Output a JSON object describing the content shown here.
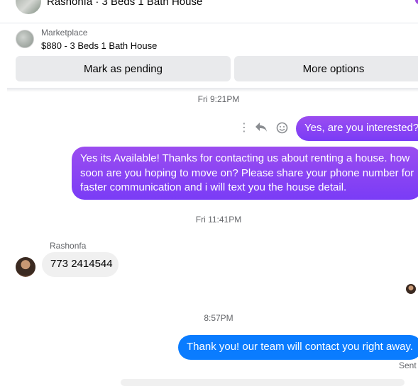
{
  "header": {
    "title": "Rashonfa · 3 Beds 1 Bath House"
  },
  "marketplace": {
    "label": "Marketplace",
    "listing": "$880 - 3 Beds 1 Bath House",
    "mark_pending_label": "Mark as pending",
    "more_options_label": "More options"
  },
  "timestamps": {
    "t1": "Fri 9:21PM",
    "t2": "Fri 11:41PM",
    "t3": "8:57PM"
  },
  "messages": {
    "m1": "Yes, are you interested?",
    "m2": "Yes its Available! Thanks for contacting us about renting a house. how soon are you hoping to move on? Please share your phone number for faster communication and i will text you the house detail.",
    "sender_name": "Rashonfa",
    "m3": "773 2414544",
    "m4": "Thank you! our team will contact you right away.",
    "status": "Sent"
  },
  "colors": {
    "outgoing_purple": "#8a3ffc",
    "outgoing_blue": "#0a7cff",
    "incoming_grey": "#f0f0f0"
  },
  "icons": [
    "more-vertical-icon",
    "reply-icon",
    "emoji-icon"
  ]
}
